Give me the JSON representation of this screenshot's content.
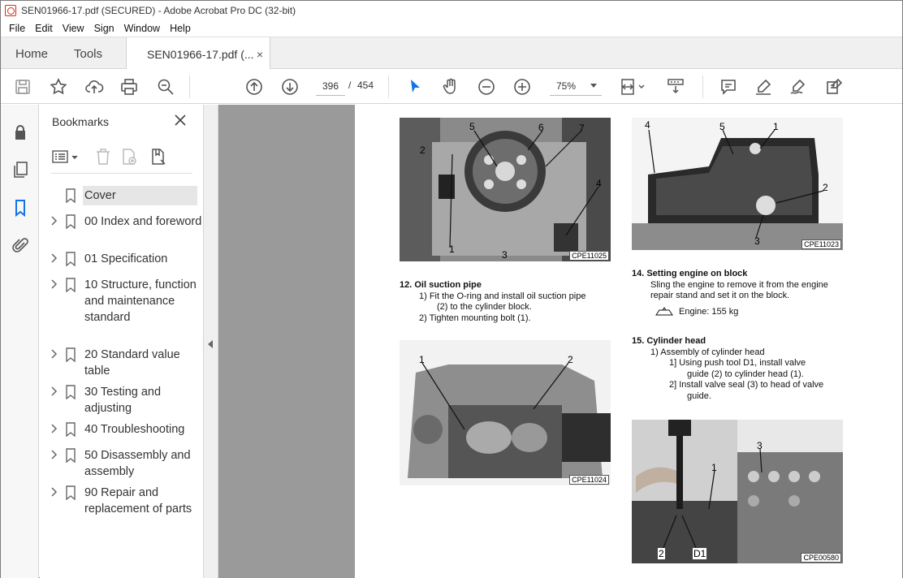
{
  "window": {
    "title": "SEN01966-17.pdf (SECURED) - Adobe Acrobat Pro DC (32-bit)"
  },
  "menu": [
    "File",
    "Edit",
    "View",
    "Sign",
    "Window",
    "Help"
  ],
  "tabs": {
    "home": "Home",
    "tools": "Tools",
    "document": "SEN01966-17.pdf (...",
    "close_glyph": "×"
  },
  "toolbar": {
    "current_page": "396",
    "page_separator": "/",
    "total_pages": "454",
    "zoom": "75%",
    "icons": [
      "save-icon",
      "bookmark-star-icon",
      "upload-icon",
      "print-icon",
      "zoom-search-icon",
      "page-up-icon",
      "page-down-icon",
      "select-cursor-icon",
      "hand-icon",
      "zoom-out-icon",
      "zoom-in-icon",
      "page-fit-icon",
      "scroll-mode-icon",
      "comment-icon",
      "highlight-icon",
      "sign-icon",
      "edit-icon"
    ]
  },
  "bookmarks": {
    "header": "Bookmarks",
    "close_glyph": "✕",
    "items": [
      {
        "label": "Cover",
        "expandable": false,
        "selected": true
      },
      {
        "label": "00 Index and foreword",
        "expandable": true
      },
      {
        "label": "01 Specification",
        "expandable": true
      },
      {
        "label": "10 Structure, function and maintenance standard",
        "expandable": true
      },
      {
        "label": "20 Standard value table",
        "expandable": true
      },
      {
        "label": "30 Testing and adjusting",
        "expandable": true
      },
      {
        "label": "40 Troubleshooting",
        "expandable": true
      },
      {
        "label": "50 Disassembly and assembly",
        "expandable": true
      },
      {
        "label": "90 Repair and replacement of parts",
        "expandable": true
      }
    ]
  },
  "document": {
    "photos": {
      "p1": {
        "code": "CPE11025",
        "labels": [
          "5",
          "6",
          "7",
          "2",
          "4",
          "1",
          "3"
        ]
      },
      "p2": {
        "code": "CPE11023",
        "labels": [
          "4",
          "5",
          "1",
          "2",
          "3"
        ]
      },
      "p3": {
        "code": "CPE11024",
        "labels": [
          "1",
          "2"
        ]
      },
      "p4": {
        "code": "CPE00580",
        "labels": [
          "1",
          "3",
          "2",
          "D1"
        ]
      }
    },
    "sec12": {
      "heading": "12.  Oil suction pipe",
      "step1": "1)    Fit the O-ring and install oil suction pipe",
      "step1b": "(2) to the cylinder block.",
      "step2": "2)    Tighten mounting bolt (1)."
    },
    "sec14": {
      "heading": "14.  Setting engine on block",
      "line1": "Sling the engine to remove it from the engine",
      "line2": "repair stand and set it on the block.",
      "weight": "Engine: 155 kg"
    },
    "sec15": {
      "heading": "15.  Cylinder head",
      "sub1": "1)    Assembly of cylinder head",
      "a1": "1]     Using push tool D1, install valve",
      "a1b": "guide (2) to cylinder head (1).",
      "a2": "2]     Install valve seal (3) to head of valve",
      "a2b": "guide."
    }
  }
}
